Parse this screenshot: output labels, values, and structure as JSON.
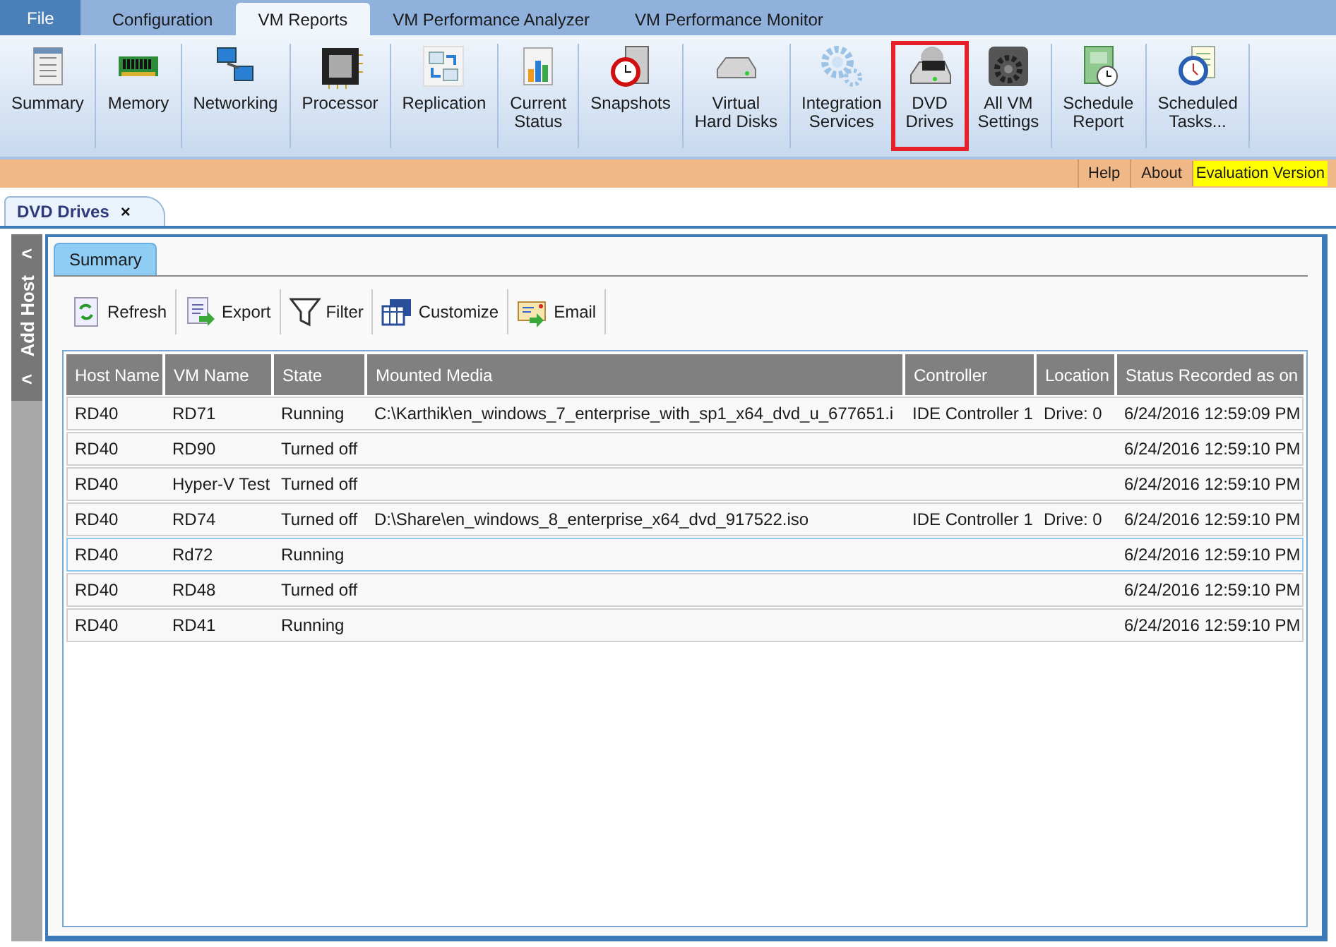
{
  "menu_tabs": [
    {
      "label": "File",
      "kind": "file",
      "selected": false
    },
    {
      "label": "Configuration",
      "kind": "tab",
      "selected": false
    },
    {
      "label": "VM Reports",
      "kind": "tab",
      "selected": true
    },
    {
      "label": "VM Performance Analyzer",
      "kind": "tab",
      "selected": false
    },
    {
      "label": "VM Performance Monitor",
      "kind": "tab",
      "selected": false
    }
  ],
  "ribbon": {
    "items": [
      {
        "label": "Summary",
        "selected": false
      },
      {
        "label": "Memory",
        "selected": false
      },
      {
        "label": "Networking",
        "selected": false
      },
      {
        "label": "Processor",
        "selected": false
      },
      {
        "label": "Replication",
        "selected": false
      },
      {
        "label": "Current\nStatus",
        "selected": false
      },
      {
        "label": "Snapshots",
        "selected": false
      },
      {
        "label": "Virtual\nHard Disks",
        "selected": false
      },
      {
        "label": "Integration\nServices",
        "selected": false
      },
      {
        "label": "DVD\nDrives",
        "selected": true
      },
      {
        "label": "All VM\nSettings",
        "selected": false
      },
      {
        "label": "Schedule\nReport",
        "selected": false
      },
      {
        "label": "Scheduled\nTasks...",
        "selected": false
      }
    ]
  },
  "info_bar": {
    "links": [
      "Help",
      "About"
    ],
    "badge": "Evaluation Version"
  },
  "document_tab": {
    "title": "DVD Drives",
    "close": "×"
  },
  "side_panel": {
    "label": "Add Host",
    "arrow": "<"
  },
  "view_tab": {
    "label": "Summary"
  },
  "toolbar": [
    "Refresh",
    "Export",
    "Filter",
    "Customize",
    "Email"
  ],
  "table": {
    "columns": [
      "Host Name",
      "VM Name",
      "State",
      "Mounted Media",
      "Controller",
      "Location",
      "Status Recorded as on"
    ],
    "rows": [
      {
        "cells": [
          "RD40",
          "RD71",
          "Running",
          "C:\\Karthik\\en_windows_7_enterprise_with_sp1_x64_dvd_u_677651.i",
          "IDE Controller 1",
          "Drive: 0",
          "6/24/2016 12:59:09 PM"
        ],
        "selected": false
      },
      {
        "cells": [
          "RD40",
          "RD90",
          "Turned off",
          "",
          "",
          "",
          "6/24/2016 12:59:10 PM"
        ],
        "selected": false
      },
      {
        "cells": [
          "RD40",
          "Hyper-V Test",
          "Turned off",
          "",
          "",
          "",
          "6/24/2016 12:59:10 PM"
        ],
        "selected": false
      },
      {
        "cells": [
          "RD40",
          "RD74",
          "Turned off",
          "D:\\Share\\en_windows_8_enterprise_x64_dvd_917522.iso",
          "IDE Controller 1",
          "Drive: 0",
          "6/24/2016 12:59:10 PM"
        ],
        "selected": false
      },
      {
        "cells": [
          "RD40",
          "Rd72",
          "Running",
          "",
          "",
          "",
          "6/24/2016 12:59:10 PM"
        ],
        "selected": true
      },
      {
        "cells": [
          "RD40",
          "RD48",
          "Turned off",
          "",
          "",
          "",
          "6/24/2016 12:59:10 PM"
        ],
        "selected": false
      },
      {
        "cells": [
          "RD40",
          "RD41",
          "Running",
          "",
          "",
          "",
          "6/24/2016 12:59:10 PM"
        ],
        "selected": false
      }
    ]
  }
}
